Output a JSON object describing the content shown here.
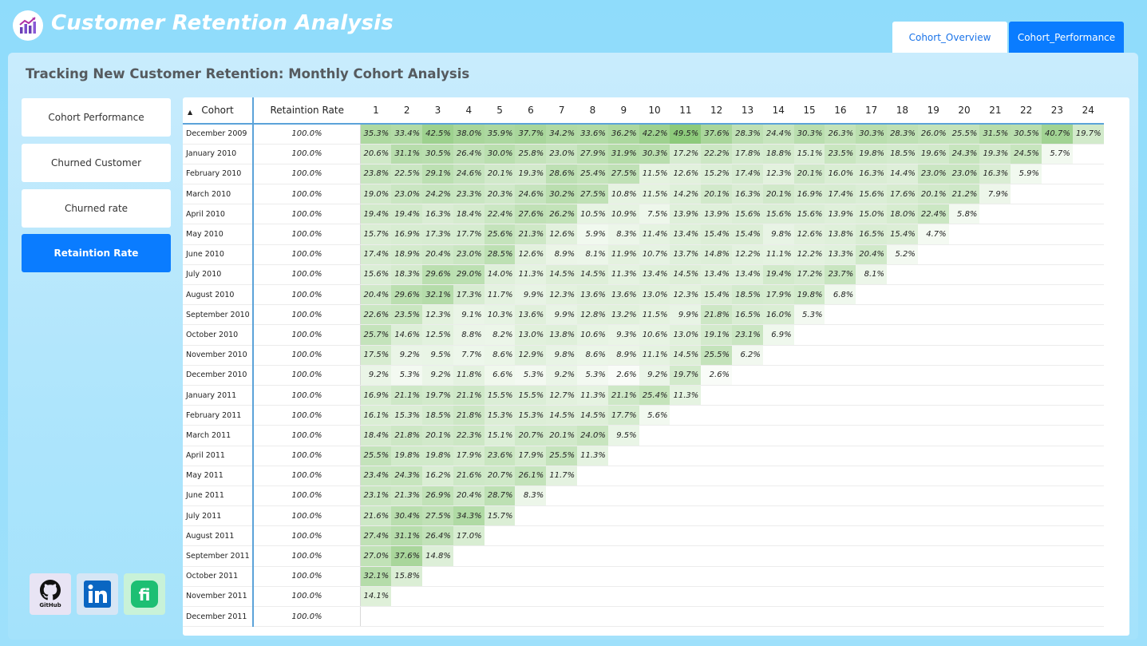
{
  "header": {
    "title": "Customer Retention Analysis",
    "tabs": [
      "Cohort_Overview",
      "Cohort_Performance"
    ],
    "active_tab": "Cohort_Performance"
  },
  "panel": {
    "title": "Tracking New Customer Retention: Monthly Cohort Analysis"
  },
  "sidebar": {
    "items": [
      {
        "label": "Cohort Performance"
      },
      {
        "label": "Churned Customer"
      },
      {
        "label": "Churned rate"
      },
      {
        "label": "Retaintion Rate"
      }
    ],
    "active": "Retaintion Rate"
  },
  "social": {
    "github_label": "GitHub"
  },
  "colors": {
    "accent": "#0a7cff",
    "heat_max": "#8cc97a",
    "heat_min": "#ffffff"
  },
  "table": {
    "headers": {
      "cohort": "Cohort",
      "rate": "Retaintion Rate",
      "months": [
        "1",
        "2",
        "3",
        "4",
        "5",
        "6",
        "7",
        "8",
        "9",
        "10",
        "11",
        "12",
        "13",
        "14",
        "15",
        "16",
        "17",
        "18",
        "19",
        "20",
        "21",
        "22",
        "23",
        "24"
      ]
    },
    "rows": [
      {
        "cohort": "December 2009",
        "rate": "100.0%",
        "values": [
          "35.3%",
          "33.4%",
          "42.5%",
          "38.0%",
          "35.9%",
          "37.7%",
          "34.2%",
          "33.6%",
          "36.2%",
          "42.2%",
          "49.5%",
          "37.6%",
          "28.3%",
          "24.4%",
          "30.3%",
          "26.3%",
          "30.3%",
          "28.3%",
          "26.0%",
          "25.5%",
          "31.5%",
          "30.5%",
          "40.7%",
          "19.7%"
        ]
      },
      {
        "cohort": "January 2010",
        "rate": "100.0%",
        "values": [
          "20.6%",
          "31.1%",
          "30.5%",
          "26.4%",
          "30.0%",
          "25.8%",
          "23.0%",
          "27.9%",
          "31.9%",
          "30.3%",
          "17.2%",
          "22.2%",
          "17.8%",
          "18.8%",
          "15.1%",
          "23.5%",
          "19.8%",
          "18.5%",
          "19.6%",
          "24.3%",
          "19.3%",
          "24.5%",
          "5.7%"
        ]
      },
      {
        "cohort": "February 2010",
        "rate": "100.0%",
        "values": [
          "23.8%",
          "22.5%",
          "29.1%",
          "24.6%",
          "20.1%",
          "19.3%",
          "28.6%",
          "25.4%",
          "27.5%",
          "11.5%",
          "12.6%",
          "15.2%",
          "17.4%",
          "12.3%",
          "20.1%",
          "16.0%",
          "16.3%",
          "14.4%",
          "23.0%",
          "23.0%",
          "16.3%",
          "5.9%"
        ]
      },
      {
        "cohort": "March 2010",
        "rate": "100.0%",
        "values": [
          "19.0%",
          "23.0%",
          "24.2%",
          "23.3%",
          "20.3%",
          "24.6%",
          "30.2%",
          "27.5%",
          "10.8%",
          "11.5%",
          "14.2%",
          "20.1%",
          "16.3%",
          "20.1%",
          "16.9%",
          "17.4%",
          "15.6%",
          "17.6%",
          "20.1%",
          "21.2%",
          "7.9%"
        ]
      },
      {
        "cohort": "April 2010",
        "rate": "100.0%",
        "values": [
          "19.4%",
          "19.4%",
          "16.3%",
          "18.4%",
          "22.4%",
          "27.6%",
          "26.2%",
          "10.5%",
          "10.9%",
          "7.5%",
          "13.9%",
          "13.9%",
          "15.6%",
          "15.6%",
          "15.6%",
          "13.9%",
          "15.0%",
          "18.0%",
          "22.4%",
          "5.8%"
        ]
      },
      {
        "cohort": "May 2010",
        "rate": "100.0%",
        "values": [
          "15.7%",
          "16.9%",
          "17.3%",
          "17.7%",
          "25.6%",
          "21.3%",
          "12.6%",
          "5.9%",
          "8.3%",
          "11.4%",
          "13.4%",
          "15.4%",
          "15.4%",
          "9.8%",
          "12.6%",
          "13.8%",
          "16.5%",
          "15.4%",
          "4.7%"
        ]
      },
      {
        "cohort": "June 2010",
        "rate": "100.0%",
        "values": [
          "17.4%",
          "18.9%",
          "20.4%",
          "23.0%",
          "28.5%",
          "12.6%",
          "8.9%",
          "8.1%",
          "11.9%",
          "10.7%",
          "13.7%",
          "14.8%",
          "12.2%",
          "11.1%",
          "12.2%",
          "13.3%",
          "20.4%",
          "5.2%"
        ]
      },
      {
        "cohort": "July 2010",
        "rate": "100.0%",
        "values": [
          "15.6%",
          "18.3%",
          "29.6%",
          "29.0%",
          "14.0%",
          "11.3%",
          "14.5%",
          "14.5%",
          "11.3%",
          "13.4%",
          "14.5%",
          "13.4%",
          "13.4%",
          "19.4%",
          "17.2%",
          "23.7%",
          "8.1%"
        ]
      },
      {
        "cohort": "August 2010",
        "rate": "100.0%",
        "values": [
          "20.4%",
          "29.6%",
          "32.1%",
          "17.3%",
          "11.7%",
          "9.9%",
          "12.3%",
          "13.6%",
          "13.6%",
          "13.0%",
          "12.3%",
          "15.4%",
          "18.5%",
          "17.9%",
          "19.8%",
          "6.8%"
        ]
      },
      {
        "cohort": "September 2010",
        "rate": "100.0%",
        "values": [
          "22.6%",
          "23.5%",
          "12.3%",
          "9.1%",
          "10.3%",
          "13.6%",
          "9.9%",
          "12.8%",
          "13.2%",
          "11.5%",
          "9.9%",
          "21.8%",
          "16.5%",
          "16.0%",
          "5.3%"
        ]
      },
      {
        "cohort": "October 2010",
        "rate": "100.0%",
        "values": [
          "25.7%",
          "14.6%",
          "12.5%",
          "8.8%",
          "8.2%",
          "13.0%",
          "13.8%",
          "10.6%",
          "9.3%",
          "10.6%",
          "13.0%",
          "19.1%",
          "23.1%",
          "6.9%"
        ]
      },
      {
        "cohort": "November 2010",
        "rate": "100.0%",
        "values": [
          "17.5%",
          "9.2%",
          "9.5%",
          "7.7%",
          "8.6%",
          "12.9%",
          "9.8%",
          "8.6%",
          "8.9%",
          "11.1%",
          "14.5%",
          "25.5%",
          "6.2%"
        ]
      },
      {
        "cohort": "December 2010",
        "rate": "100.0%",
        "values": [
          "9.2%",
          "5.3%",
          "9.2%",
          "11.8%",
          "6.6%",
          "5.3%",
          "9.2%",
          "5.3%",
          "2.6%",
          "9.2%",
          "19.7%",
          "2.6%"
        ]
      },
      {
        "cohort": "January 2011",
        "rate": "100.0%",
        "values": [
          "16.9%",
          "21.1%",
          "19.7%",
          "21.1%",
          "15.5%",
          "15.5%",
          "12.7%",
          "11.3%",
          "21.1%",
          "25.4%",
          "11.3%"
        ]
      },
      {
        "cohort": "February 2011",
        "rate": "100.0%",
        "values": [
          "16.1%",
          "15.3%",
          "18.5%",
          "21.8%",
          "15.3%",
          "15.3%",
          "14.5%",
          "14.5%",
          "17.7%",
          "5.6%"
        ]
      },
      {
        "cohort": "March 2011",
        "rate": "100.0%",
        "values": [
          "18.4%",
          "21.8%",
          "20.1%",
          "22.3%",
          "15.1%",
          "20.7%",
          "20.1%",
          "24.0%",
          "9.5%"
        ]
      },
      {
        "cohort": "April 2011",
        "rate": "100.0%",
        "values": [
          "25.5%",
          "19.8%",
          "19.8%",
          "17.9%",
          "23.6%",
          "17.9%",
          "25.5%",
          "11.3%"
        ]
      },
      {
        "cohort": "May 2011",
        "rate": "100.0%",
        "values": [
          "23.4%",
          "24.3%",
          "16.2%",
          "21.6%",
          "20.7%",
          "26.1%",
          "11.7%"
        ]
      },
      {
        "cohort": "June 2011",
        "rate": "100.0%",
        "values": [
          "23.1%",
          "21.3%",
          "26.9%",
          "20.4%",
          "28.7%",
          "8.3%"
        ]
      },
      {
        "cohort": "July 2011",
        "rate": "100.0%",
        "values": [
          "21.6%",
          "30.4%",
          "27.5%",
          "34.3%",
          "15.7%"
        ]
      },
      {
        "cohort": "August 2011",
        "rate": "100.0%",
        "values": [
          "27.4%",
          "31.1%",
          "26.4%",
          "17.0%"
        ]
      },
      {
        "cohort": "September 2011",
        "rate": "100.0%",
        "values": [
          "27.0%",
          "37.6%",
          "14.8%"
        ]
      },
      {
        "cohort": "October 2011",
        "rate": "100.0%",
        "values": [
          "32.1%",
          "15.8%"
        ]
      },
      {
        "cohort": "November 2011",
        "rate": "100.0%",
        "values": [
          "14.1%"
        ]
      },
      {
        "cohort": "December 2011",
        "rate": "100.0%",
        "values": []
      }
    ]
  }
}
